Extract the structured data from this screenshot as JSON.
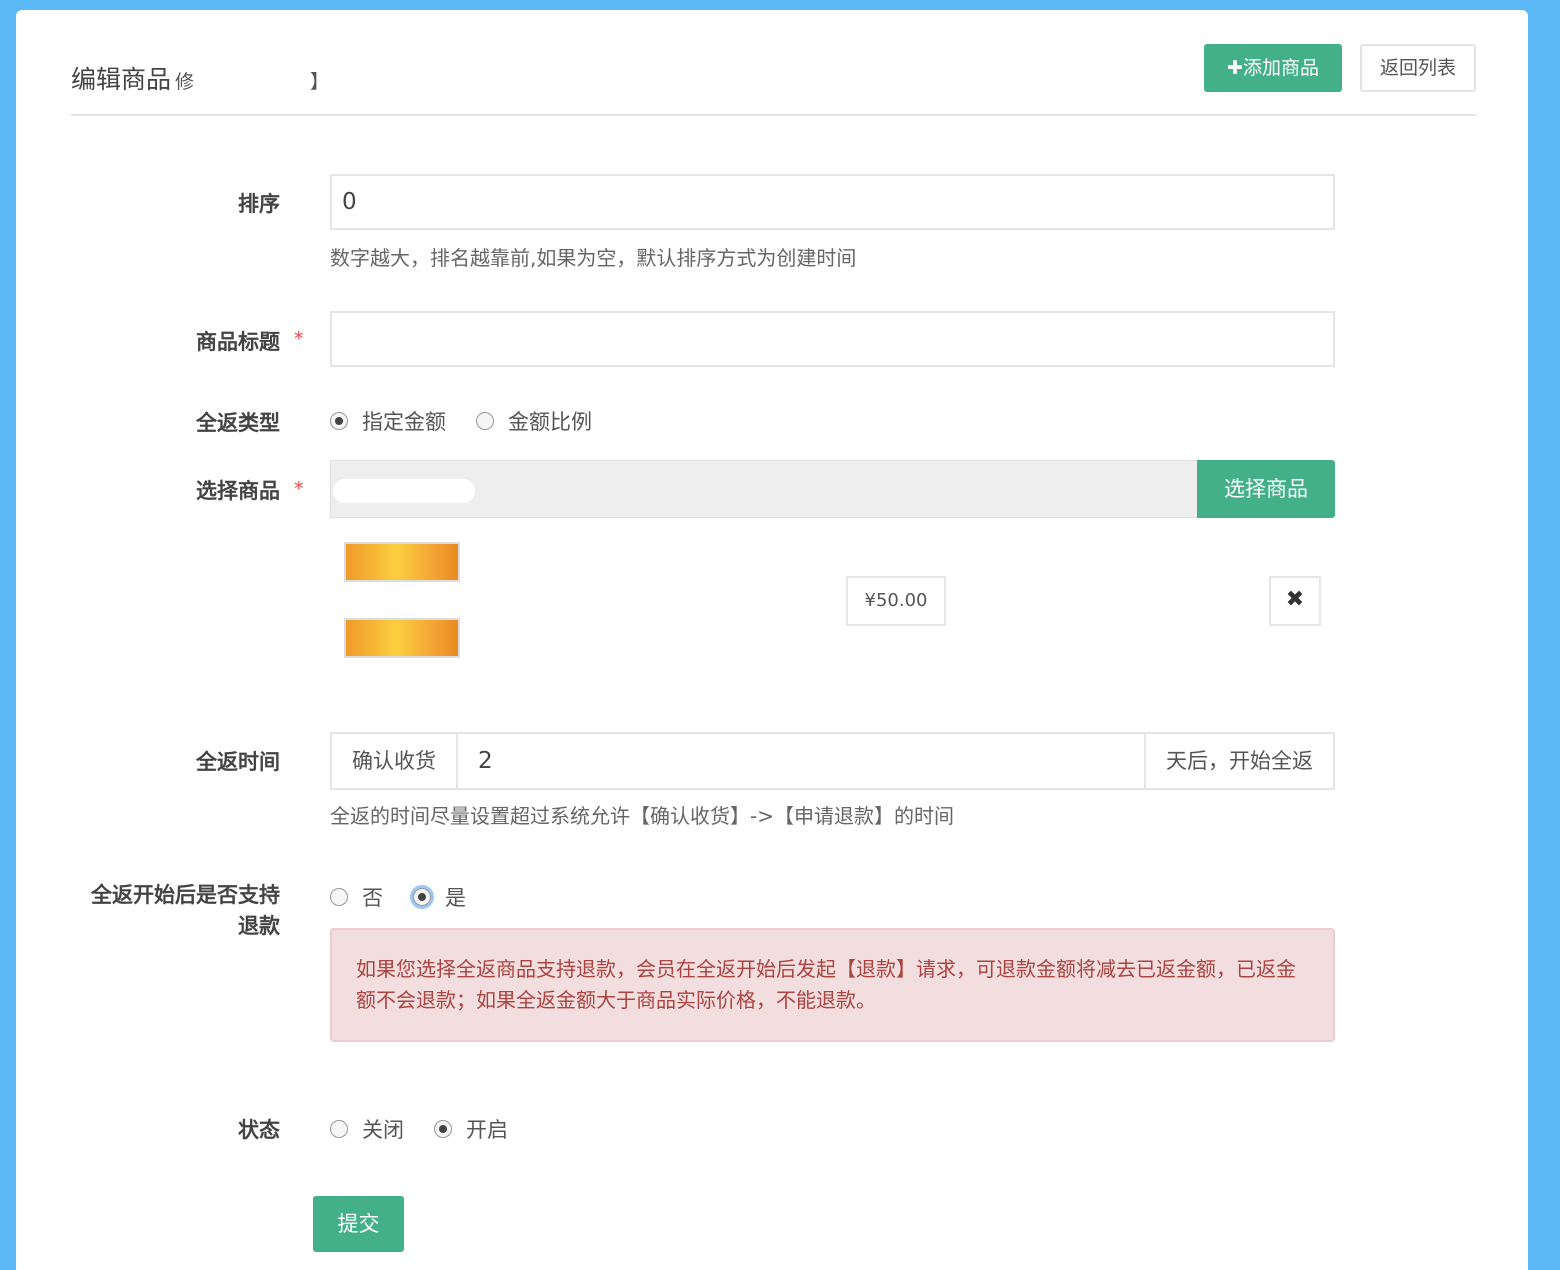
{
  "header": {
    "title": "编辑商品",
    "subtitle_start": "修",
    "subtitle_end": "】",
    "add_button": "✚添加商品",
    "back_button": "返回列表"
  },
  "form": {
    "sort": {
      "label": "排序",
      "value": "0",
      "help": "数字越大，排名越靠前,如果为空，默认排序方式为创建时间"
    },
    "title": {
      "label": "商品标题",
      "required_mark": "*",
      "value": ""
    },
    "return_type": {
      "label": "全返类型",
      "options": [
        "指定金额",
        "金额比例"
      ],
      "selected": "指定金额"
    },
    "select_goods": {
      "label": "选择商品",
      "required_mark": "*",
      "button": "选择商品",
      "price": "¥50.00",
      "remove_icon": "✖"
    },
    "return_time": {
      "label": "全返时间",
      "prefix": "确认收货",
      "value": "2",
      "suffix": "天后，开始全返",
      "help": "全返的时间尽量设置超过系统允许【确认收货】->【申请退款】的时间"
    },
    "refund": {
      "label": "全返开始后是否支持退款",
      "options": [
        "否",
        "是"
      ],
      "selected": "是",
      "alert": "如果您选择全返商品支持退款，会员在全返开始后发起【退款】请求，可退款金额将减去已返金额，已返金额不会退款；如果全返金额大于商品实际价格，不能退款。"
    },
    "status": {
      "label": "状态",
      "options": [
        "关闭",
        "开启"
      ],
      "selected": "开启"
    },
    "submit": "提交"
  },
  "colors": {
    "primary": "#44b08a",
    "background": "#5bb8f5",
    "alert_bg": "#f2dede",
    "alert_text": "#a94442",
    "required": "#ee4444"
  }
}
